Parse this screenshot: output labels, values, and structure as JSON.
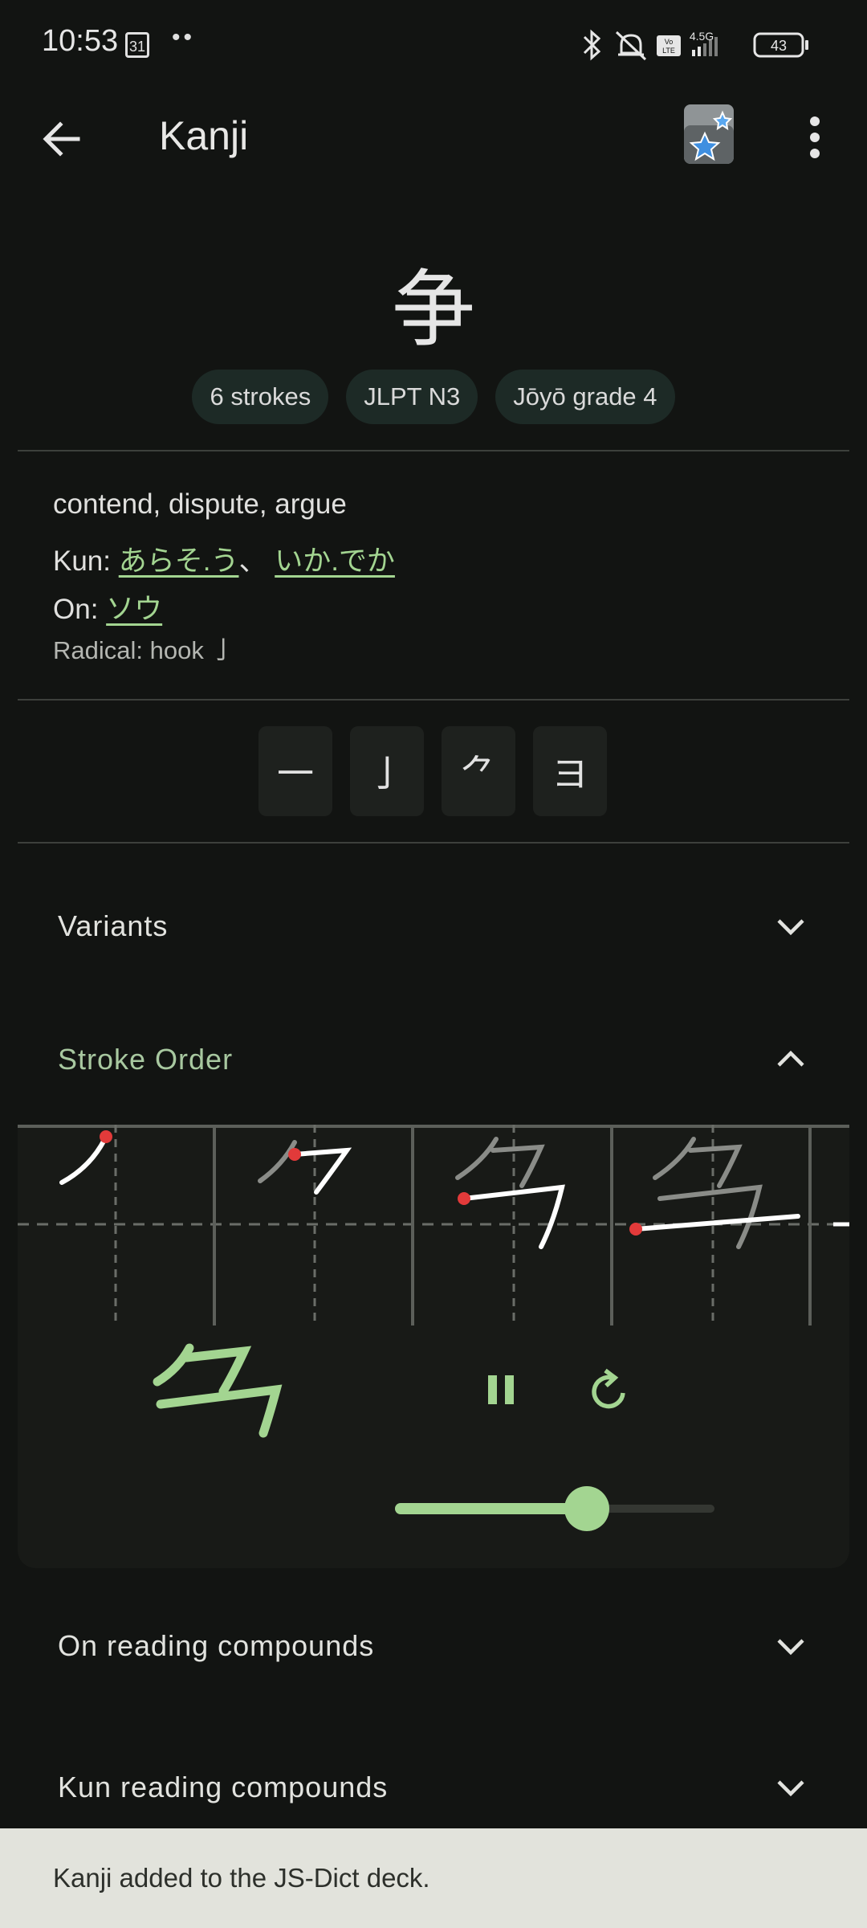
{
  "status_bar": {
    "time": "10:53",
    "calendar_date": "31",
    "network": "4.5G",
    "volte": "Vo LTE",
    "battery": "43"
  },
  "app_bar": {
    "title": "Kanji",
    "back_icon": "arrow-back-icon",
    "anki_icon": "anki-star-icon",
    "more_icon": "more-vert-icon"
  },
  "kanji": {
    "character": "争",
    "chips": [
      "6 strokes",
      "JLPT N3",
      "Jōyō grade 4"
    ]
  },
  "details": {
    "meaning": "contend, dispute, argue",
    "kun_label": "Kun: ",
    "kun_readings": [
      "あらそ.う",
      "いか.でか"
    ],
    "kun_separator": "、 ",
    "on_label": "On: ",
    "on_readings": [
      "ソウ"
    ],
    "radical": "Radical: hook 亅"
  },
  "components": [
    "一",
    "亅",
    "⺈",
    "ヨ"
  ],
  "sections": {
    "variants": "Variants",
    "stroke_order": "Stroke Order",
    "on_compounds": "On reading compounds",
    "kun_compounds": "Kun reading compounds"
  },
  "stroke_player": {
    "pause_icon": "pause-icon",
    "replay_icon": "replay-icon",
    "speed_level": 0.6
  },
  "snackbar": {
    "message": "Kanji added to the JS-Dict deck."
  },
  "colors": {
    "background": "#121412",
    "accent": "#a3d591",
    "stroke_start": "#e23a3a"
  }
}
